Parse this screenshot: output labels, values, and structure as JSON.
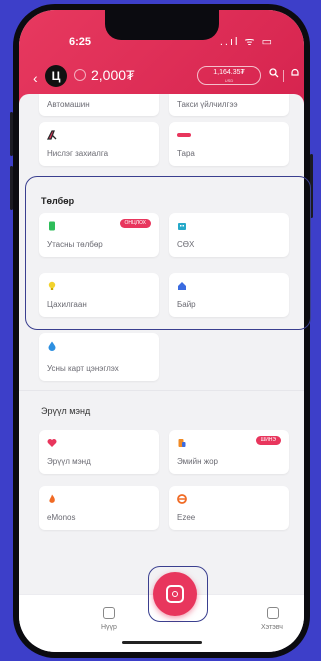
{
  "status_bar": {
    "time": "6:25",
    "icons": "..ıl ᯤ ▭"
  },
  "header": {
    "logo_letter": "Ц",
    "points": "2,000₮",
    "rate": {
      "value": "1,164.35₮",
      "sub": "USD"
    },
    "accent": "#e7395f"
  },
  "tiles_top": [
    {
      "label": "Автомашин"
    },
    {
      "label": "Такси үйлчилгээ"
    }
  ],
  "tiles_row2": [
    {
      "label": "Нислэг захиалга",
      "icon": "airline-icon",
      "icon_color": "#e8365d"
    },
    {
      "label": "Тара",
      "icon": "tara-logo-icon",
      "icon_color": "#e8365d"
    }
  ],
  "section_payments": {
    "title": "Төлбөр",
    "tiles": [
      {
        "label": "Утасны төлбөр",
        "badge": "ОНЦЛОХ",
        "icon": "phone-bill-icon",
        "icon_color": "#2ebd5a"
      },
      {
        "label": "СӨХ",
        "icon": "building-icon",
        "icon_color": "#26a9c9"
      },
      {
        "label": "Цахилгаан",
        "icon": "lightbulb-icon",
        "icon_color": "#f2d22c"
      },
      {
        "label": "Байр",
        "icon": "house-icon",
        "icon_color": "#3a6be0"
      },
      {
        "label": "Усны карт цэнэглэх",
        "icon": "water-drop-icon",
        "icon_color": "#2d8fe0"
      }
    ]
  },
  "section_health": {
    "title": "Эрүүл мэнд",
    "tiles": [
      {
        "label": "Эрүүл мэнд",
        "icon": "heart-icon",
        "icon_color": "#e8365d"
      },
      {
        "label": "Эмийн жор",
        "badge": "ШИНЭ",
        "icon": "prescription-icon",
        "icon_color": "#f08a24"
      },
      {
        "label": "eMonos",
        "icon": "flame-icon",
        "icon_color": "#f06a24"
      },
      {
        "label": "Ezee",
        "icon": "ezee-logo-icon",
        "icon_color": "#f06a24"
      }
    ]
  },
  "tabbar": {
    "home_label": "Нүүр",
    "wallet_label": "Хэтэвч"
  }
}
